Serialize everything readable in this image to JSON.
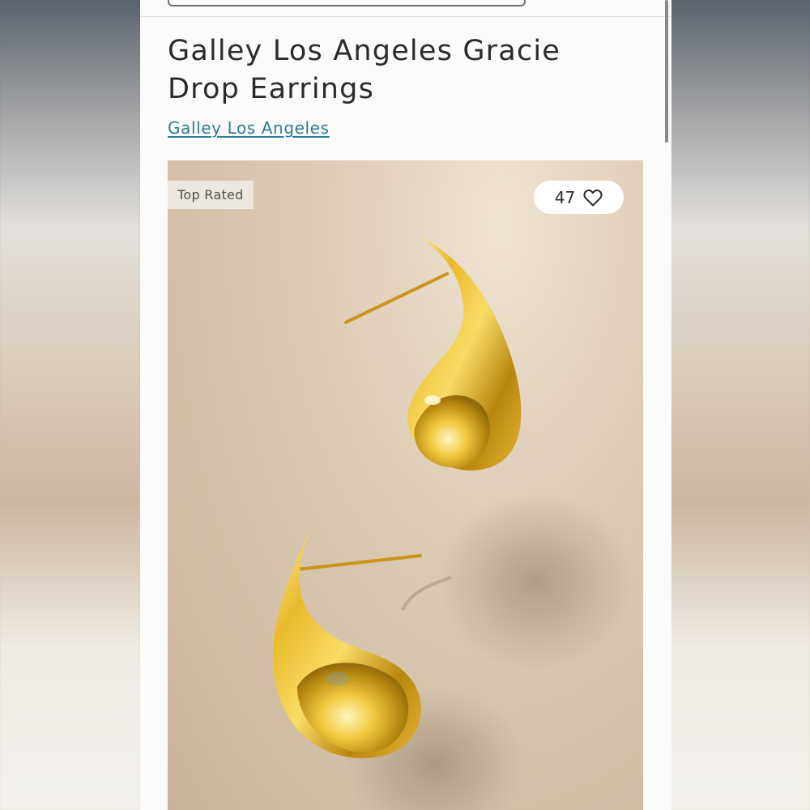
{
  "product": {
    "title": "Galley Los Angeles Gracie Drop Earrings",
    "brand": "Galley Los Angeles"
  },
  "image": {
    "badge": "Top Rated",
    "likes": "47",
    "like_icon": "heart-outline-icon"
  },
  "colors": {
    "link": "#2f7d92",
    "gold": "#d9ad2a",
    "background_beige": "#d6c3aa"
  }
}
